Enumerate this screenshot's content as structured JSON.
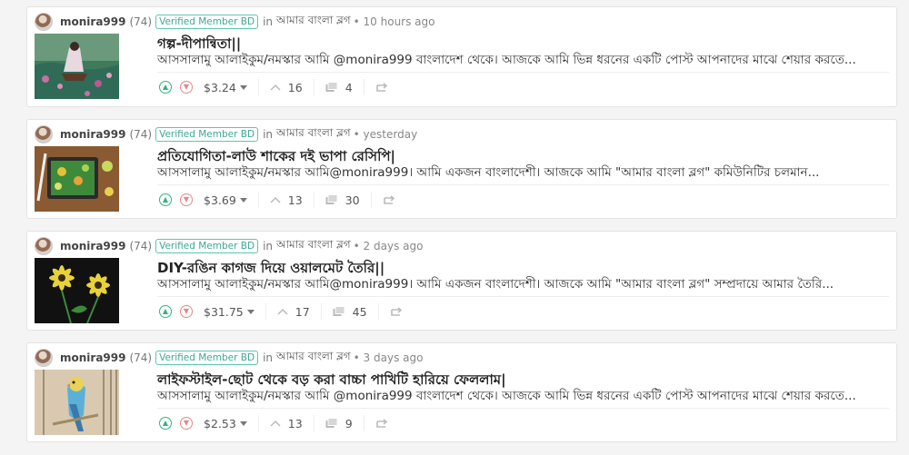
{
  "posts": [
    {
      "author": "monira999",
      "rep": "(74)",
      "badge": "Verified Member BD",
      "in_label": "in",
      "community": "আমার বাংলা ব্লগ",
      "time": "• 10 hours ago",
      "title": "গল্প-দীপান্বিতা||",
      "excerpt": "আসসালামু আলাইকুম/নমস্কার আমি @monira999 বাংলাদেশ থেকে। আজকে আমি ভিন্ন ধরনের একটি পোস্ট আপনাদের মাঝে শেয়ার করতে...",
      "payout": "$3.24",
      "votes": "16",
      "comments": "4"
    },
    {
      "author": "monira999",
      "rep": "(74)",
      "badge": "Verified Member BD",
      "in_label": "in",
      "community": "আমার বাংলা ব্লগ",
      "time": "• yesterday",
      "title": "প্রতিযোগিতা-লাউ শাকের দই ভাপা রেসিপি|",
      "excerpt": "আসসালামু আলাইকুম/নমস্কার আমি@monira999। আমি একজন বাংলাদেশী। আজকে আমি \"আমার বাংলা ব্লগ\" কমিউনিটির চলমান...",
      "payout": "$3.69",
      "votes": "13",
      "comments": "30"
    },
    {
      "author": "monira999",
      "rep": "(74)",
      "badge": "Verified Member BD",
      "in_label": "in",
      "community": "আমার বাংলা ব্লগ",
      "time": "• 2 days ago",
      "title": "DIY-রঙিন কাগজ দিয়ে ওয়ালমেট তৈরি||",
      "excerpt": "আসসালামু আলাইকুম/নমস্কার আমি@monira999। আমি একজন বাংলাদেশী। আজকে আমি \"আমার বাংলা ব্লগ\" সম্প্রদায়ে আমার তৈরি...",
      "payout": "$31.75",
      "votes": "17",
      "comments": "45"
    },
    {
      "author": "monira999",
      "rep": "(74)",
      "badge": "Verified Member BD",
      "in_label": "in",
      "community": "আমার বাংলা ব্লগ",
      "time": "• 3 days ago",
      "title": "লাইফস্টাইল-ছোট থেকে বড় করা বাচ্চা পাখিটি হারিয়ে ফেললাম|",
      "excerpt": "আসসালামু আলাইকুম/নমস্কার আমি @monira999 বাংলাদেশ থেকে। আজকে আমি ভিন্ন ধরনের একটি পোস্ট আপনাদের মাঝে শেয়ার করতে...",
      "payout": "$2.53",
      "votes": "13",
      "comments": "9"
    }
  ],
  "icons": {
    "upvote": "upvote-icon",
    "downvote": "downvote-icon",
    "payout_dropdown": "chevron-down-icon",
    "votes": "upvote-count-icon",
    "comments": "comment-icon",
    "reblog": "reblog-icon"
  },
  "colors": {
    "upvote": "#36b37e",
    "downvote": "#e48989",
    "badge": "#3fa796"
  }
}
